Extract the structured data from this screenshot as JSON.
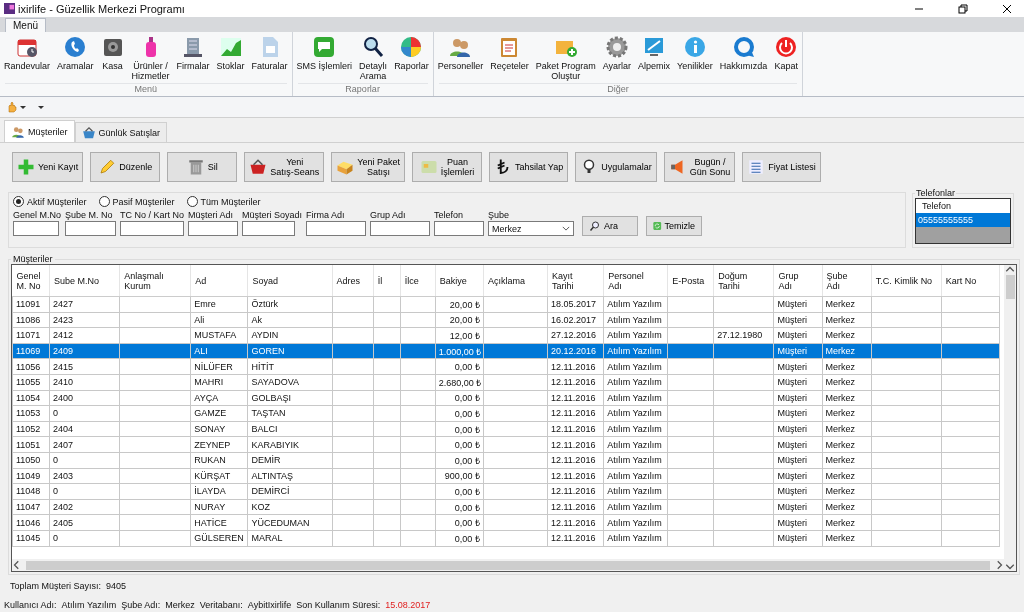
{
  "window": {
    "title": "ixirlife - Güzellik Merkezi Programı"
  },
  "menu_tabs": [
    {
      "label": "Menü",
      "selected": true
    }
  ],
  "ribbon": [
    {
      "label": "Menü",
      "items": [
        "Randevular",
        "Aramalar",
        "Kasa",
        "Ürünler /\nHizmetler",
        "Firmalar",
        "Stoklar",
        "Faturalar"
      ]
    },
    {
      "label": "Raporlar",
      "items": [
        "SMS İşlemleri",
        "Detaylı\nArama",
        "Raporlar"
      ]
    },
    {
      "label": "Diğer",
      "items": [
        "Personeller",
        "Reçeteler",
        "Paket Program\nOluştur",
        "Ayarlar",
        "Alpemix",
        "Yenilikler",
        "Hakkımızda",
        "Kapat"
      ]
    }
  ],
  "tabs": [
    {
      "label": "Müşteriler",
      "selected": true
    },
    {
      "label": "Günlük Satışlar",
      "selected": false
    }
  ],
  "actions": [
    "Yeni Kayıt",
    "Düzenle",
    "Sil",
    "Yeni\nSatış-Seans",
    "Yeni Paket\nSatışı",
    "Puan\nİşlemleri",
    "Tahsilat Yap",
    "Uygulamalar",
    "Bugün /\nGün Sonu",
    "Fiyat Listesi"
  ],
  "filter": {
    "options": [
      {
        "label": "Aktif Müşteriler",
        "selected": true
      },
      {
        "label": "Pasif Müşteriler",
        "selected": false
      },
      {
        "label": "Tüm Müşteriler",
        "selected": false
      }
    ],
    "fields": [
      {
        "label": "Genel M.No",
        "kind": "text"
      },
      {
        "label": "Şube M. No",
        "kind": "text"
      },
      {
        "label": "TC No / Kart No",
        "kind": "text"
      },
      {
        "label": "Müşteri Adı",
        "kind": "text"
      },
      {
        "label": "Müşteri Soyadı",
        "kind": "text"
      },
      {
        "label": "Firma Adı",
        "kind": "text"
      },
      {
        "label": "Grup Adı",
        "kind": "text"
      },
      {
        "label": "Telefon",
        "kind": "text"
      },
      {
        "label": "Şube",
        "kind": "select",
        "value": "Merkez"
      }
    ],
    "buttons": [
      "Ara",
      "Temizle"
    ]
  },
  "phones": {
    "title": "Telefonlar",
    "header": "Telefon",
    "items": [
      {
        "label": "05555555555",
        "selected": true
      }
    ]
  },
  "grid": {
    "title": "Müşteriler",
    "columns": [
      {
        "label": "Genel\nM. No",
        "kind": "text"
      },
      {
        "label": "Sube M.No",
        "kind": "text"
      },
      {
        "label": "Anlaşmalı\nKurum",
        "kind": "text"
      },
      {
        "label": "Ad",
        "kind": "text"
      },
      {
        "label": "Soyad",
        "kind": "text"
      },
      {
        "label": "Adres",
        "kind": "text"
      },
      {
        "label": "İl",
        "kind": "text"
      },
      {
        "label": "İlce",
        "kind": "text"
      },
      {
        "label": "Bakiye",
        "kind": "number"
      },
      {
        "label": "Açıklama",
        "kind": "text"
      },
      {
        "label": "Kayıt\nTarihi",
        "kind": "text"
      },
      {
        "label": "Personel\nAdı",
        "kind": "text"
      },
      {
        "label": "E-Posta",
        "kind": "text"
      },
      {
        "label": "Doğum\nTarihi",
        "kind": "text"
      },
      {
        "label": "Grup\nAdı",
        "kind": "text"
      },
      {
        "label": "Şube\nAdı",
        "kind": "text"
      },
      {
        "label": "T.C. Kimlik No",
        "kind": "text"
      },
      {
        "label": "Kart No",
        "kind": "text"
      }
    ],
    "rows": [
      {
        "selected": false,
        "genel": "11091",
        "sube": "2427",
        "ad": "Emre",
        "soyad": "Öztürk",
        "bakiye": "20,00 ₺",
        "kayit": "18.05.2017",
        "personel": "Atılım Yazılım",
        "grup": "Müşteri",
        "sube_adi": "Merkez"
      },
      {
        "selected": false,
        "genel": "11086",
        "sube": "2423",
        "ad": "Ali",
        "soyad": "Ak",
        "bakiye": "20,00 ₺",
        "kayit": "16.02.2017",
        "personel": "Atılım Yazılım",
        "grup": "Müşteri",
        "sube_adi": "Merkez"
      },
      {
        "selected": false,
        "genel": "11071",
        "sube": "2412",
        "ad": "MUSTAFA",
        "soyad": "AYDIN",
        "bakiye": "12,00 ₺",
        "kayit": "27.12.2016",
        "personel": "Atılım Yazılım",
        "dogum": "27.12.1980",
        "grup": "Müşteri",
        "sube_adi": "Merkez"
      },
      {
        "selected": true,
        "genel": "11069",
        "sube": "2409",
        "ad": "ALI",
        "soyad": "GOREN",
        "bakiye": "1.000,00 ₺",
        "kayit": "20.12.2016",
        "personel": "Atılım Yazılım",
        "grup": "Müşteri",
        "sube_adi": "Merkez"
      },
      {
        "selected": false,
        "genel": "11056",
        "sube": "2415",
        "ad": "NİLÜFER",
        "soyad": "HİTİT",
        "bakiye": "0,00 ₺",
        "kayit": "12.11.2016",
        "personel": "Atılım Yazılım",
        "grup": "Müşteri",
        "sube_adi": "Merkez"
      },
      {
        "selected": false,
        "genel": "11055",
        "sube": "2410",
        "ad": "MAHRI",
        "soyad": "SAYADOVA",
        "bakiye": "2.680,00 ₺",
        "kayit": "12.11.2016",
        "personel": "Atılım Yazılım",
        "grup": "Müşteri",
        "sube_adi": "Merkez"
      },
      {
        "selected": false,
        "genel": "11054",
        "sube": "2400",
        "ad": "AYÇA",
        "soyad": "GOLBAŞI",
        "bakiye": "0,00 ₺",
        "kayit": "12.11.2016",
        "personel": "Atılım Yazılım",
        "grup": "Müşteri",
        "sube_adi": "Merkez"
      },
      {
        "selected": false,
        "genel": "11053",
        "sube": "0",
        "ad": "GAMZE",
        "soyad": "TAŞTAN",
        "bakiye": "0,00 ₺",
        "kayit": "12.11.2016",
        "personel": "Atılım Yazılım",
        "grup": "Müşteri",
        "sube_adi": "Merkez"
      },
      {
        "selected": false,
        "genel": "11052",
        "sube": "2404",
        "ad": "SONAY",
        "soyad": "BALCI",
        "bakiye": "0,00 ₺",
        "kayit": "12.11.2016",
        "personel": "Atılım Yazılım",
        "grup": "Müşteri",
        "sube_adi": "Merkez"
      },
      {
        "selected": false,
        "genel": "11051",
        "sube": "2407",
        "ad": "ZEYNEP",
        "soyad": "KARABIYIK",
        "bakiye": "0,00 ₺",
        "kayit": "12.11.2016",
        "personel": "Atılım Yazılım",
        "grup": "Müşteri",
        "sube_adi": "Merkez"
      },
      {
        "selected": false,
        "genel": "11050",
        "sube": "0",
        "ad": "RUKAN",
        "soyad": "DEMİR",
        "bakiye": "0,00 ₺",
        "kayit": "12.11.2016",
        "personel": "Atılım Yazılım",
        "grup": "Müşteri",
        "sube_adi": "Merkez"
      },
      {
        "selected": false,
        "genel": "11049",
        "sube": "2403",
        "ad": "KÜRŞAT",
        "soyad": "ALTINTAŞ",
        "bakiye": "900,00 ₺",
        "kayit": "12.11.2016",
        "personel": "Atılım Yazılım",
        "grup": "Müşteri",
        "sube_adi": "Merkez"
      },
      {
        "selected": false,
        "genel": "11048",
        "sube": "0",
        "ad": "İLAYDA",
        "soyad": "DEMİRCİ",
        "bakiye": "0,00 ₺",
        "kayit": "12.11.2016",
        "personel": "Atılım Yazılım",
        "grup": "Müşteri",
        "sube_adi": "Merkez"
      },
      {
        "selected": false,
        "genel": "11047",
        "sube": "2402",
        "ad": "NURAY",
        "soyad": "KOZ",
        "bakiye": "0,00 ₺",
        "kayit": "12.11.2016",
        "personel": "Atılım Yazılım",
        "grup": "Müşteri",
        "sube_adi": "Merkez"
      },
      {
        "selected": false,
        "genel": "11046",
        "sube": "2405",
        "ad": "HATİCE",
        "soyad": "YÜCEDUMAN",
        "bakiye": "0,00 ₺",
        "kayit": "12.11.2016",
        "personel": "Atılım Yazılım",
        "grup": "Müşteri",
        "sube_adi": "Merkez"
      },
      {
        "selected": false,
        "genel": "11045",
        "sube": "0",
        "ad": "GÜLSEREN",
        "soyad": "MARAL",
        "bakiye": "0,00 ₺",
        "kayit": "12.11.2016",
        "personel": "Atılım Yazılım",
        "grup": "Müşteri",
        "sube_adi": "Merkez"
      }
    ]
  },
  "total": {
    "label": "Toplam Müşteri Sayısı:",
    "value": "9405"
  },
  "status_bar": [
    {
      "label": "Kullanıcı Adı:",
      "value": "Atılım Yazılım",
      "highlighted": false
    },
    {
      "label": "Şube Adı:",
      "value": "Merkez",
      "highlighted": false
    },
    {
      "label": "Veritabanı:",
      "value": "AybitIxirlife",
      "highlighted": false
    },
    {
      "label": "Son Kullanım Süresi:",
      "value": "15.08.2017",
      "highlighted": true
    }
  ]
}
